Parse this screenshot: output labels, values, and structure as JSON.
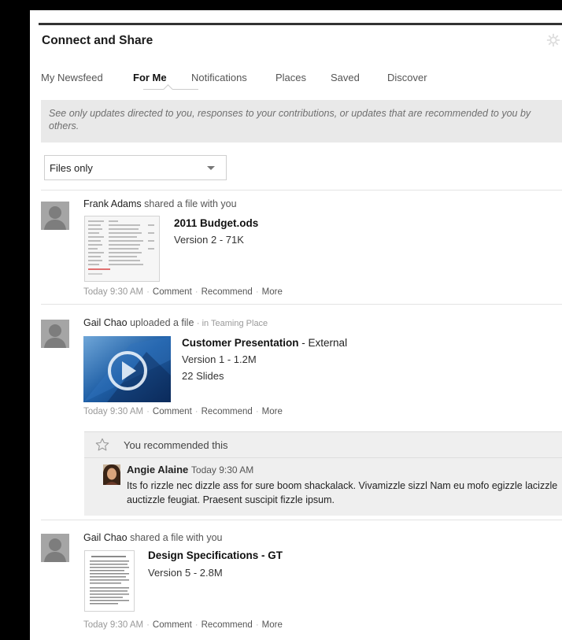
{
  "widget": {
    "title": "Connect and Share",
    "gear_icon": "gear-icon"
  },
  "tabs": [
    {
      "label": "My Newsfeed",
      "active": false
    },
    {
      "label": "For Me",
      "active": true
    },
    {
      "label": "Notifications",
      "active": false
    },
    {
      "label": "Places",
      "active": false
    },
    {
      "label": "Saved",
      "active": false
    },
    {
      "label": "Discover",
      "active": false
    }
  ],
  "info": {
    "text": "See only updates directed to you, responses to your contributions, or updates that are recommended to you by others."
  },
  "filter": {
    "selected": "Files only"
  },
  "actions": {
    "comment": "Comment",
    "recommend": "Recommend",
    "more": "More",
    "separator": "·"
  },
  "feed": [
    {
      "actor": "Frank Adams",
      "verb": "shared a file with you",
      "context": "",
      "file_title": "2011 Budget.ods",
      "file_extra": "",
      "lines": [
        "Version 2 - 71K"
      ],
      "time": "Today 9:30 AM"
    },
    {
      "actor": "Gail Chao",
      "verb": "uploaded a file",
      "context": "· in Teaming Place",
      "file_title": "Customer Presentation",
      "file_extra": " - External",
      "lines": [
        "Version 1 - 1.2M",
        "22 Slides"
      ],
      "time": "Today 9:30 AM"
    },
    {
      "actor": "Gail Chao",
      "verb": "shared a file with you",
      "context": "",
      "file_title": "Design Specifications - GT",
      "file_extra": "",
      "lines": [
        "Version 5 - 2.8M"
      ],
      "time": "Today 9:30 AM"
    }
  ],
  "recommendation": {
    "text": "You recommended this",
    "star_icon": "star-outline-icon",
    "comment_author": "Angie Alaine",
    "comment_time": "Today 9:30 AM",
    "comment_body": "Its fo rizzle nec dizzle ass for sure boom shackalack. Vivamizzle sizzl Nam eu mofo egizzle lacizzle auctizzle feugiat. Praesent suscipit fizzle ipsum."
  }
}
